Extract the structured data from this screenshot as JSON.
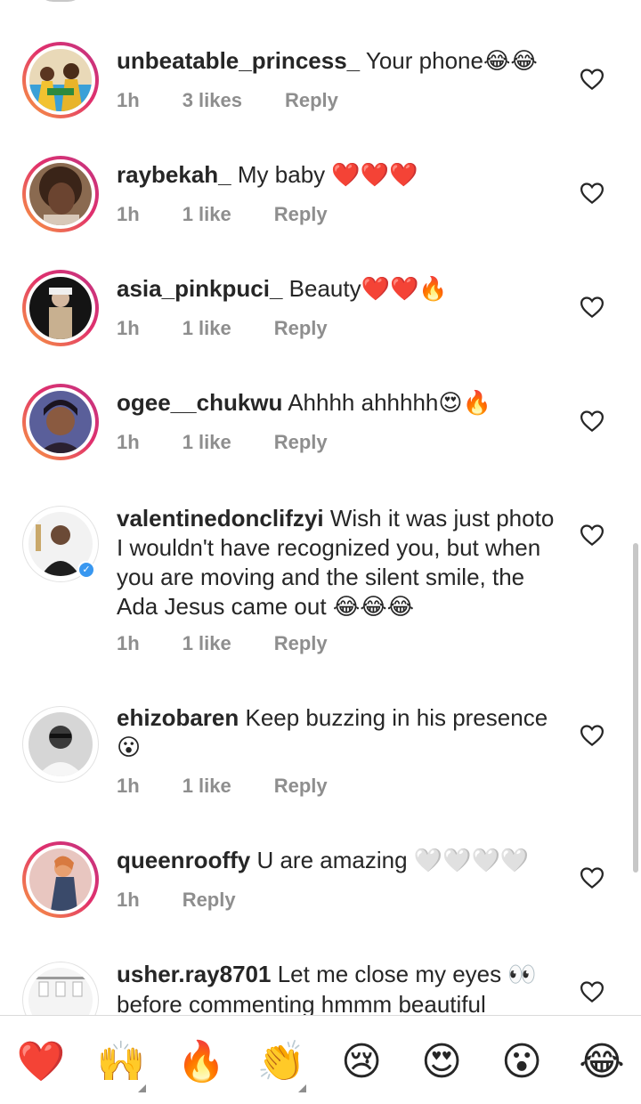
{
  "comments": [
    {
      "user": "unbeatable_princess_",
      "text": "Your phone",
      "emojis": "😂😂",
      "time": "1h",
      "likes": "3 likes",
      "reply": "Reply"
    },
    {
      "user": "raybekah_",
      "text": "My baby",
      "emojis": "❤️❤️❤️",
      "time": "1h",
      "likes": "1 like",
      "reply": "Reply"
    },
    {
      "user": "asia_pinkpuci_",
      "text": "Beauty",
      "emojis": "❤️❤️🔥",
      "time": "1h",
      "likes": "1 like",
      "reply": "Reply"
    },
    {
      "user": "ogee__chukwu",
      "text": "Ahhhh ahhhhh",
      "emojis": "😍🔥",
      "time": "1h",
      "likes": "1 like",
      "reply": "Reply"
    },
    {
      "user": "valentinedonclifzyi",
      "text": "Wish it was just photo I wouldn't have recognized you, but when you are moving and the silent smile, the Ada Jesus came out",
      "emojis": "😂😂😂",
      "time": "1h",
      "likes": "1 like",
      "reply": "Reply"
    },
    {
      "user": "ehizobaren",
      "text": "Keep buzzing in his presence",
      "emojis": "😮",
      "time": "1h",
      "likes": "1 like",
      "reply": "Reply"
    },
    {
      "user": "queenrooffy",
      "text": "U are amazing",
      "emojis": "🤍🤍🤍🤍",
      "time": "1h",
      "likes": "",
      "reply": "Reply"
    },
    {
      "user": "usher.ray8701",
      "text": "Let me close my eyes",
      "emojis": "👀",
      "text2": "before commenting hmmm beautiful",
      "time": "",
      "likes": "",
      "reply": ""
    }
  ],
  "reactions": [
    "❤️",
    "🙌",
    "🔥",
    "👏",
    "😢",
    "😍",
    "😮",
    "😂"
  ],
  "colors": {
    "heart_icon": "#262626",
    "meta_text": "#8e8e8e",
    "verified": "#3897f0"
  }
}
